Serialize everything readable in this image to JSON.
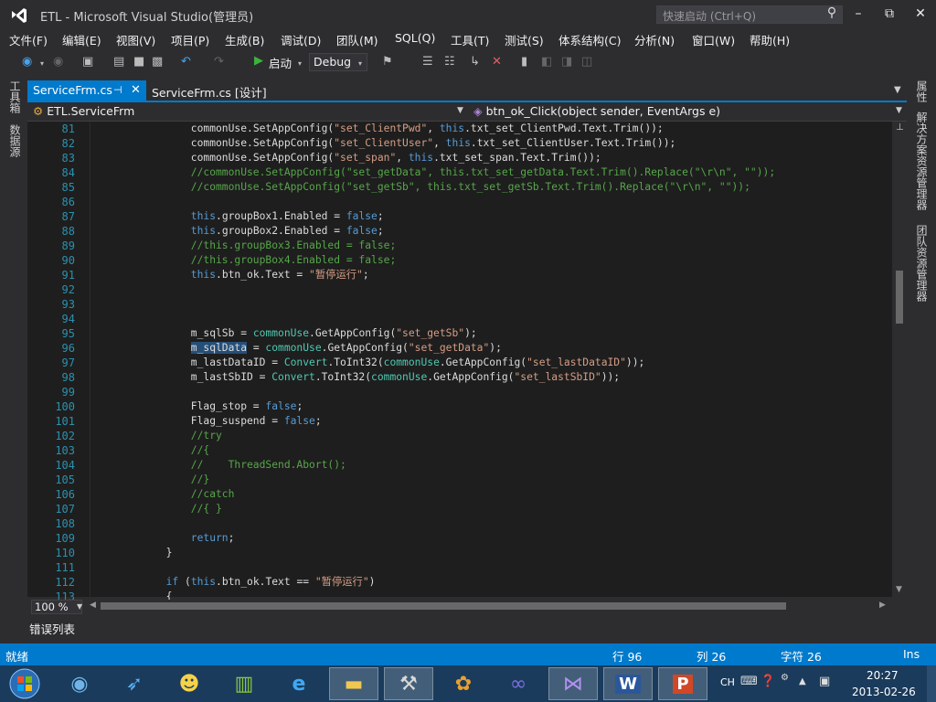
{
  "window": {
    "title": "ETL - Microsoft Visual Studio(管理员)",
    "quick_launch_placeholder": "快速启动 (Ctrl+Q)",
    "minimize": "–",
    "maximize": "⧉",
    "close": "✕"
  },
  "menu": [
    "文件(F)",
    "编辑(E)",
    "视图(V)",
    "项目(P)",
    "生成(B)",
    "调试(D)",
    "团队(M)",
    "SQL(Q)",
    "工具(T)",
    "测试(S)",
    "体系结构(C)",
    "分析(N)",
    "窗口(W)",
    "帮助(H)"
  ],
  "toolbar": {
    "start_label": "启动",
    "config_value": "Debug"
  },
  "left_panels": [
    "工具箱",
    "数据源"
  ],
  "right_panels": [
    "属性",
    "解决方案资源管理器",
    "团队资源管理器"
  ],
  "tabs": [
    {
      "label": "ServiceFrm.cs",
      "active": true
    },
    {
      "label": "ServiceFrm.cs [设计]",
      "active": false
    }
  ],
  "navbar": {
    "class": "ETL.ServiceFrm",
    "method": "btn_ok_Click(object sender, EventArgs e)"
  },
  "code_lines": [
    {
      "n": "81",
      "indent": 16,
      "tokens": [
        [
          "",
          "commonUse"
        ],
        [
          "",
          ".SetAppConfig("
        ],
        [
          "st",
          "\"set_ClientPwd\""
        ],
        [
          "",
          ", "
        ],
        [
          "kw",
          "this"
        ],
        [
          "",
          ".txt_set_ClientPwd.Text.Trim());"
        ]
      ]
    },
    {
      "n": "82",
      "indent": 16,
      "tokens": [
        [
          "",
          "commonUse"
        ],
        [
          "",
          ".SetAppConfig("
        ],
        [
          "st",
          "\"set_ClientUser\""
        ],
        [
          "",
          ", "
        ],
        [
          "kw",
          "this"
        ],
        [
          "",
          ".txt_set_ClientUser.Text.Trim());"
        ]
      ]
    },
    {
      "n": "83",
      "indent": 16,
      "tokens": [
        [
          "",
          "commonUse"
        ],
        [
          "",
          ".SetAppConfig("
        ],
        [
          "st",
          "\"set_span\""
        ],
        [
          "",
          ", "
        ],
        [
          "kw",
          "this"
        ],
        [
          "",
          ".txt_set_span.Text.Trim());"
        ]
      ]
    },
    {
      "n": "84",
      "indent": 16,
      "tokens": [
        [
          "cm",
          "//commonUse.SetAppConfig(\"set_getData\", this.txt_set_getData.Text.Trim().Replace(\"\\r\\n\", \"\"));"
        ]
      ]
    },
    {
      "n": "85",
      "indent": 16,
      "tokens": [
        [
          "cm",
          "//commonUse.SetAppConfig(\"set_getSb\", this.txt_set_getSb.Text.Trim().Replace(\"\\r\\n\", \"\"));"
        ]
      ]
    },
    {
      "n": "86",
      "indent": 0,
      "tokens": []
    },
    {
      "n": "87",
      "indent": 16,
      "tokens": [
        [
          "kw",
          "this"
        ],
        [
          "",
          ".groupBox1.Enabled = "
        ],
        [
          "kw",
          "false"
        ],
        [
          "",
          ";"
        ]
      ]
    },
    {
      "n": "88",
      "indent": 16,
      "tokens": [
        [
          "kw",
          "this"
        ],
        [
          "",
          ".groupBox2.Enabled = "
        ],
        [
          "kw",
          "false"
        ],
        [
          "",
          ";"
        ]
      ]
    },
    {
      "n": "89",
      "indent": 16,
      "tokens": [
        [
          "cm",
          "//this.groupBox3.Enabled = false;"
        ]
      ]
    },
    {
      "n": "90",
      "indent": 16,
      "tokens": [
        [
          "cm",
          "//this.groupBox4.Enabled = false;"
        ]
      ]
    },
    {
      "n": "91",
      "indent": 16,
      "tokens": [
        [
          "kw",
          "this"
        ],
        [
          "",
          ".btn_ok.Text = "
        ],
        [
          "st",
          "\"暂停运行\""
        ],
        [
          "",
          ";"
        ]
      ]
    },
    {
      "n": "92",
      "indent": 0,
      "tokens": []
    },
    {
      "n": "93",
      "indent": 0,
      "tokens": []
    },
    {
      "n": "94",
      "indent": 0,
      "tokens": []
    },
    {
      "n": "95",
      "indent": 16,
      "tokens": [
        [
          "",
          "m_sqlSb = "
        ],
        [
          "ty",
          "commonUse"
        ],
        [
          "",
          ".GetAppConfig("
        ],
        [
          "st",
          "\"set_getSb\""
        ],
        [
          "",
          ");"
        ]
      ]
    },
    {
      "n": "96",
      "indent": 16,
      "tokens": [
        [
          "sel",
          "m_sqlData"
        ],
        [
          "",
          " = "
        ],
        [
          "ty",
          "commonUse"
        ],
        [
          "",
          ".GetAppConfig("
        ],
        [
          "st",
          "\"set_getData\""
        ],
        [
          "",
          ");"
        ]
      ]
    },
    {
      "n": "97",
      "indent": 16,
      "tokens": [
        [
          "",
          "m_lastDataID = "
        ],
        [
          "ty",
          "Convert"
        ],
        [
          "",
          ".ToInt32("
        ],
        [
          "ty",
          "commonUse"
        ],
        [
          "",
          ".GetAppConfig("
        ],
        [
          "st",
          "\"set_lastDataID\""
        ],
        [
          "",
          "));"
        ]
      ]
    },
    {
      "n": "98",
      "indent": 16,
      "tokens": [
        [
          "",
          "m_lastSbID = "
        ],
        [
          "ty",
          "Convert"
        ],
        [
          "",
          ".ToInt32("
        ],
        [
          "ty",
          "commonUse"
        ],
        [
          "",
          ".GetAppConfig("
        ],
        [
          "st",
          "\"set_lastSbID\""
        ],
        [
          "",
          "));"
        ]
      ]
    },
    {
      "n": "99",
      "indent": 0,
      "tokens": []
    },
    {
      "n": "100",
      "indent": 16,
      "tokens": [
        [
          "",
          "Flag_stop = "
        ],
        [
          "kw",
          "false"
        ],
        [
          "",
          ";"
        ]
      ]
    },
    {
      "n": "101",
      "indent": 16,
      "tokens": [
        [
          "",
          "Flag_suspend = "
        ],
        [
          "kw",
          "false"
        ],
        [
          "",
          ";"
        ]
      ]
    },
    {
      "n": "102",
      "indent": 16,
      "tokens": [
        [
          "cm",
          "//try"
        ]
      ]
    },
    {
      "n": "103",
      "indent": 16,
      "tokens": [
        [
          "cm",
          "//{"
        ]
      ]
    },
    {
      "n": "104",
      "indent": 16,
      "tokens": [
        [
          "cm",
          "//    ThreadSend.Abort();"
        ]
      ]
    },
    {
      "n": "105",
      "indent": 16,
      "tokens": [
        [
          "cm",
          "//}"
        ]
      ]
    },
    {
      "n": "106",
      "indent": 16,
      "tokens": [
        [
          "cm",
          "//catch"
        ]
      ]
    },
    {
      "n": "107",
      "indent": 16,
      "tokens": [
        [
          "cm",
          "//{ }"
        ]
      ]
    },
    {
      "n": "108",
      "indent": 0,
      "tokens": []
    },
    {
      "n": "109",
      "indent": 16,
      "tokens": [
        [
          "kw",
          "return"
        ],
        [
          "",
          ";"
        ]
      ]
    },
    {
      "n": "110",
      "indent": 12,
      "tokens": [
        [
          "",
          "}"
        ]
      ]
    },
    {
      "n": "111",
      "indent": 0,
      "tokens": []
    },
    {
      "n": "112",
      "indent": 12,
      "tokens": [
        [
          "kw",
          "if"
        ],
        [
          "",
          " ("
        ],
        [
          "kw",
          "this"
        ],
        [
          "",
          ".btn_ok.Text == "
        ],
        [
          "st",
          "\"暂停运行\""
        ],
        [
          "",
          ")"
        ]
      ]
    },
    {
      "n": "113",
      "indent": 12,
      "tokens": [
        [
          "",
          "{"
        ]
      ]
    }
  ],
  "zoom": "100 %",
  "error_list_label": "错误列表",
  "status": {
    "ready": "就绪",
    "line": "行 96",
    "col": "列 26",
    "char": "字符 26",
    "mode": "Ins"
  },
  "tray": {
    "ime": "CH",
    "time": "20:27",
    "date": "2013-02-26"
  },
  "taskbar_icons": [
    "windows-start-icon",
    "media-player-icon",
    "bird-app-icon",
    "qq-penguin-icon",
    "server-manager-icon",
    "internet-explorer-icon",
    "file-explorer-icon",
    "tools-icon",
    "color-wheel-icon",
    "infinity-app-icon",
    "visual-studio-icon",
    "word-icon",
    "powerpoint-icon"
  ],
  "colors": {
    "accent": "#007acc",
    "editor_bg": "#1e1e1e",
    "chrome_bg": "#2d2d30",
    "comment": "#57a64a",
    "keyword": "#569cd6",
    "type": "#4ec9b0",
    "string": "#d69d85",
    "line_number": "#2b91af"
  }
}
